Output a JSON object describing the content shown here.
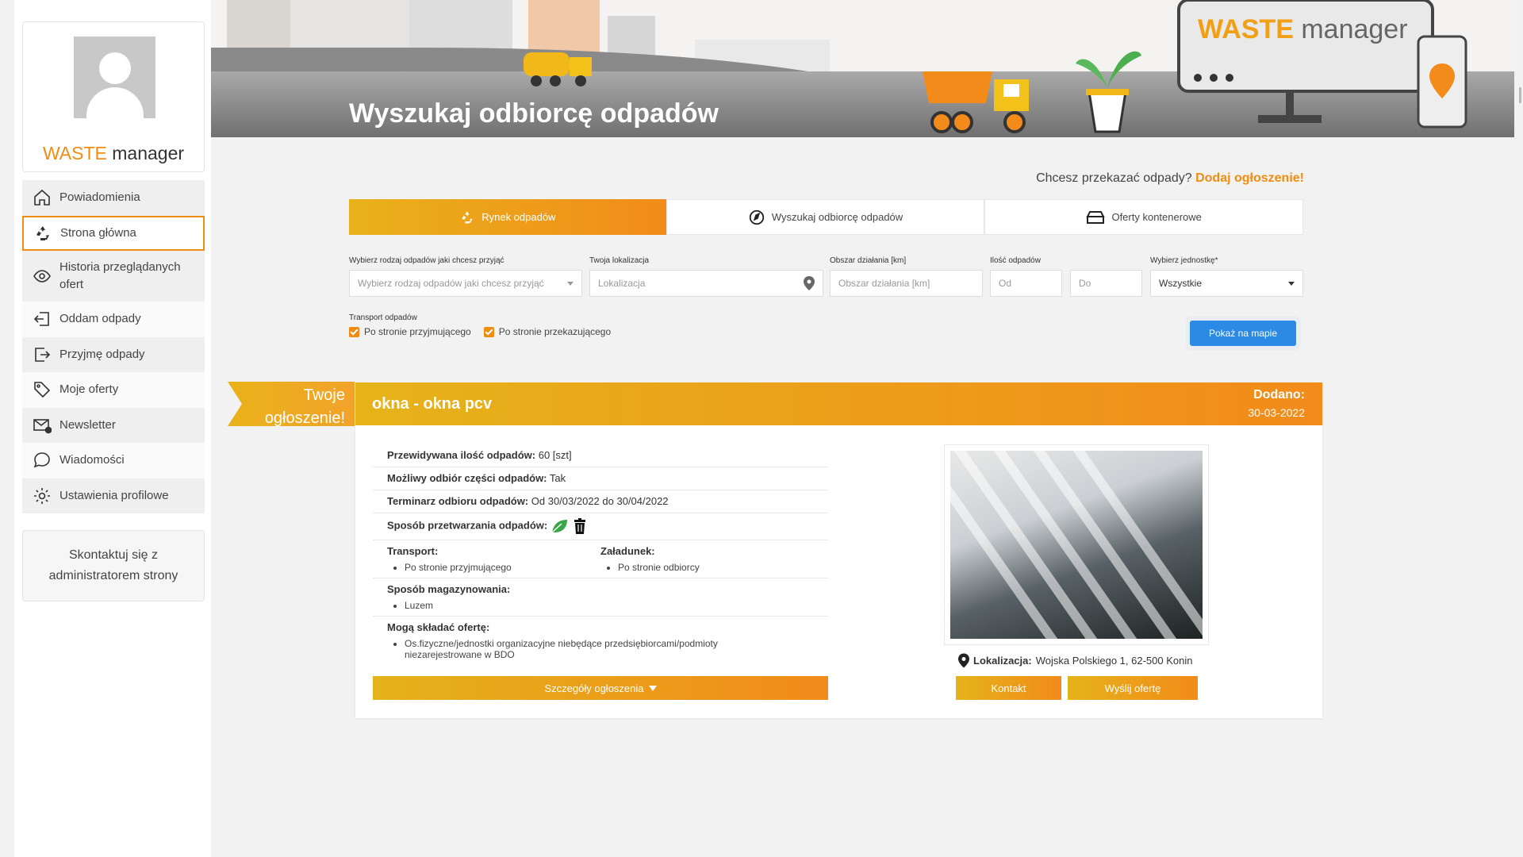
{
  "sidebar": {
    "brand_part1": "WASTE",
    "brand_part2": " manager",
    "items": [
      {
        "label": "Powiadomienia",
        "icon": "home-icon"
      },
      {
        "label": "Strona główna",
        "icon": "recycle-icon"
      },
      {
        "label": "Historia przeglądanych ofert",
        "icon": "eye-icon"
      },
      {
        "label": "Oddam odpady",
        "icon": "sign-out-icon"
      },
      {
        "label": "Przyjmę odpady",
        "icon": "sign-in-icon"
      },
      {
        "label": "Moje oferty",
        "icon": "tags-icon"
      },
      {
        "label": "Newsletter",
        "icon": "envelope-icon"
      },
      {
        "label": "Wiadomości",
        "icon": "chat-icon"
      },
      {
        "label": "Ustawienia profilowe",
        "icon": "gear-icon"
      }
    ],
    "active_item": "Strona główna",
    "contact_line1": "Skontaktuj się z",
    "contact_line2": "administratorem strony"
  },
  "banner": {
    "title": "Wyszukaj odbiorcę odpadów",
    "brand_part1": "WASTE",
    "brand_part2": " manager"
  },
  "cta": {
    "text": "Chcesz przekazać odpady?",
    "link": "Dodaj ogłoszenie!"
  },
  "tabs": [
    {
      "label": "Rynek odpadów",
      "icon": "recycle-icon",
      "active": true
    },
    {
      "label": "Wyszukaj odbiorcę odpadów",
      "icon": "compass-icon",
      "active": false
    },
    {
      "label": "Oferty kontenerowe",
      "icon": "container-icon",
      "active": false
    }
  ],
  "filters": {
    "waste_type": {
      "label": "Wybierz rodzaj odpadów jaki chcesz przyjąć",
      "placeholder": "Wybierz rodzaj odpadów jaki chcesz przyjąć"
    },
    "location": {
      "label": "Twoja lokalizacja",
      "placeholder": "Lokalizacja"
    },
    "area": {
      "label": "Obszar działania [km]",
      "placeholder": "Obszar działania [km]"
    },
    "quantity": {
      "label": "Ilość odpadów",
      "from_placeholder": "Od",
      "to_placeholder": "Do"
    },
    "unit": {
      "label": "Wybierz jednostkę",
      "required_mark": "*",
      "value": "Wszystkie"
    }
  },
  "transport": {
    "label": "Transport odpadów",
    "options": [
      {
        "label": "Po stronie przyjmującego",
        "checked": true
      },
      {
        "label": "Po stronie przekazującego",
        "checked": true
      }
    ]
  },
  "map_button": "Pokaż na mapie",
  "listing": {
    "ribbon_line1": "Twoje",
    "ribbon_line2": "ogłoszenie!",
    "title": "okna - okna pcv",
    "added_label": "Dodano:",
    "added_date": "30-03-2022",
    "quantity_label": "Przewidywana ilość odpadów:",
    "quantity_value": "60 [szt]",
    "partial_label": "Możliwy odbiór części odpadów:",
    "partial_value": "Tak",
    "schedule_label": "Terminarz odbioru odpadów:",
    "schedule_value": "Od 30/03/2022 do 30/04/2022",
    "processing_label": "Sposób przetwarzania odpadów:",
    "transport_label": "Transport:",
    "transport_value": "Po stronie przyjmującego",
    "loading_label": "Załadunek:",
    "loading_value": "Po stronie odbiorcy",
    "storage_label": "Sposób magazynowania:",
    "storage_value": "Luzem",
    "bidders_label": "Mogą składać ofertę:",
    "bidders_value": "Os.fizyczne/jednostki organizacyjne niebędące przedsiębiorcami/podmioty niezarejestrowane w BDO",
    "details_button": "Szczegóły ogłoszenia",
    "location_label": "Lokalizacja:",
    "location_value": "Wojska Polskiego 1, 62-500 Konin",
    "contact_button": "Kontakt",
    "offer_button": "Wyślij ofertę"
  },
  "colors": {
    "accent": "#f08c12",
    "accent_yellow": "#e6b31a",
    "map_button": "#2a8ae6"
  }
}
